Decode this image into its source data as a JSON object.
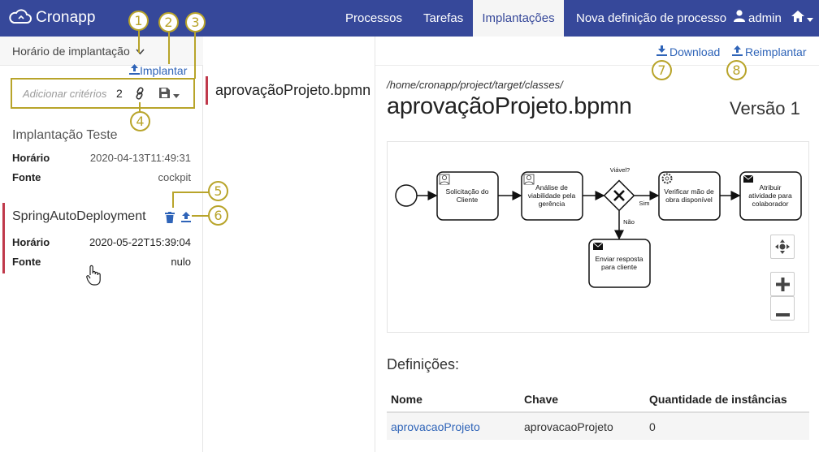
{
  "navbar": {
    "brand": "Cronapp",
    "items": [
      {
        "label": "Processos"
      },
      {
        "label": "Tarefas"
      },
      {
        "label": "Implantações",
        "active": true
      },
      {
        "label": "Nova definição de processo"
      }
    ],
    "user": "admin"
  },
  "sidebar": {
    "sort_label": "Horário de implantação",
    "deploy_link": "Implantar",
    "criteria_placeholder": "Adicionar critérios",
    "criteria_count": "2",
    "deployments": [
      {
        "title": "Implantação Teste",
        "time_key": "Horário",
        "time": "2020-04-13T11:49:31",
        "source_key": "Fonte",
        "source": "cockpit"
      },
      {
        "title": "SpringAutoDeployment",
        "time_key": "Horário",
        "time": "2020-05-22T15:39:04",
        "source_key": "Fonte",
        "source": "nulo"
      }
    ]
  },
  "resources": {
    "items": [
      "aprovaçãoProjeto.bpmn"
    ]
  },
  "detail": {
    "download": "Download",
    "redeploy": "Reimplantar",
    "path": "/home/cronapp/project/target/classes/",
    "title": "aprovaçãoProjeto.bpmn",
    "version": "Versão 1",
    "definitions_title": "Definições:",
    "table": {
      "columns": [
        "Nome",
        "Chave",
        "Quantidade de instâncias"
      ],
      "rows": [
        [
          "aprovacaoProjeto",
          "aprovacaoProjeto",
          "0"
        ]
      ]
    }
  },
  "diagram": {
    "tasks": [
      {
        "label_lines": [
          "Solicitação do",
          "Cliente"
        ],
        "icon": "user-icon"
      },
      {
        "label_lines": [
          "Análise de",
          "viabilidade pela",
          "gerência"
        ],
        "icon": "user-icon"
      },
      {
        "label_lines": [
          "Verificar mão de",
          "obra disponível"
        ],
        "icon": "gear-icon"
      },
      {
        "label_lines": [
          "Atribuir",
          "atividade para",
          "colaborador"
        ],
        "icon": "envelope-icon"
      },
      {
        "label_lines": [
          "Enviar resposta",
          "para cliente"
        ],
        "icon": "envelope-icon"
      }
    ],
    "gateway_label": "Viável?",
    "yes_label": "Sim",
    "no_label": "Não"
  },
  "callouts": [
    "1",
    "2",
    "3",
    "4",
    "5",
    "6",
    "7",
    "8"
  ],
  "colors": {
    "navbar": "#36489a",
    "accent": "#2f64b8",
    "selected": "#c0394b",
    "callout": "#b8a42a"
  }
}
